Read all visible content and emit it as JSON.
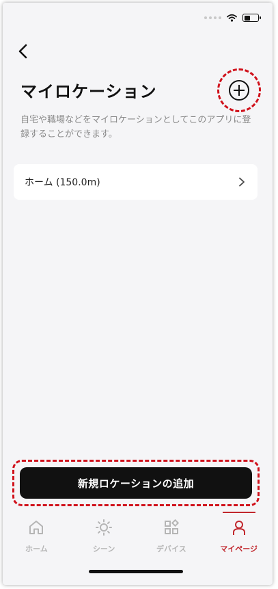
{
  "header": {
    "title": "マイロケーション",
    "description": "自宅や職場などをマイロケーションとしてこのアプリに登録することができます。"
  },
  "locations": [
    {
      "label": "ホーム (150.0m)"
    }
  ],
  "actions": {
    "add_location_label": "新規ロケーションの追加"
  },
  "tabbar": {
    "items": [
      {
        "label": "ホーム",
        "icon": "home-icon",
        "active": false
      },
      {
        "label": "シーン",
        "icon": "sun-icon",
        "active": false
      },
      {
        "label": "デバイス",
        "icon": "devices-icon",
        "active": false
      },
      {
        "label": "マイページ",
        "icon": "person-icon",
        "active": true
      }
    ]
  },
  "colors": {
    "accent": "#c1272d",
    "highlight": "#d0111b",
    "background": "#f5f5f7",
    "button": "#111111"
  }
}
